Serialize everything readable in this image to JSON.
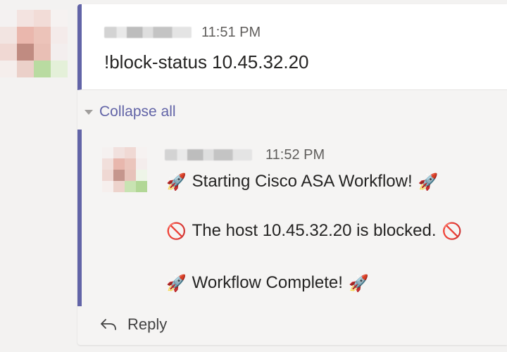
{
  "top_message": {
    "time": "11:51 PM",
    "text": "!block-status 10.45.32.20"
  },
  "thread": {
    "collapse_label": "Collapse all",
    "reply": {
      "time": "11:52 PM",
      "lines": [
        {
          "emoji_start": "🚀",
          "text": "Starting Cisco ASA Workflow!",
          "emoji_end": "🚀"
        },
        {
          "emoji_start": "🚫",
          "text": "The host 10.45.32.20 is blocked.",
          "emoji_end": "🚫"
        },
        {
          "emoji_start": "🚀",
          "text": "Workflow Complete!",
          "emoji_end": "🚀"
        }
      ]
    },
    "reply_button_label": "Reply"
  },
  "colors": {
    "accent": "#6264a7",
    "background": "#f3f2f1",
    "card": "#ffffff",
    "time_text": "#605e5c"
  },
  "icons": {
    "reply": "reply-arrow-icon",
    "collapse": "caret-down-icon",
    "avatar": "pixelated-avatar"
  }
}
